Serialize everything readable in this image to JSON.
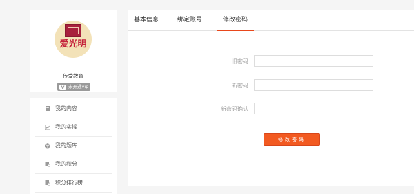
{
  "profile": {
    "logo_text": "爱光明",
    "username": "传爱教育",
    "vip_status": "未开通vip",
    "vip_mark": "V"
  },
  "sidebar": {
    "items": [
      {
        "label": "我的内容",
        "icon": "document-icon"
      },
      {
        "label": "我的实操",
        "icon": "practice-icon"
      },
      {
        "label": "我的题库",
        "icon": "question-bank-icon"
      },
      {
        "label": "我的积分",
        "icon": "points-icon"
      },
      {
        "label": "积分排行榜",
        "icon": "ranking-icon"
      }
    ]
  },
  "tabs": [
    {
      "label": "基本信息",
      "active": false
    },
    {
      "label": "绑定账号",
      "active": false
    },
    {
      "label": "修改密码",
      "active": true
    }
  ],
  "form": {
    "old_password_label": "旧密码",
    "new_password_label": "新密码",
    "confirm_password_label": "新密码确认",
    "old_password_value": "",
    "new_password_value": "",
    "confirm_password_value": "",
    "submit_label": "修改密码"
  },
  "colors": {
    "accent": "#f25a21",
    "tab_underline": "#e8481c",
    "badge_gray": "#9a9a9a",
    "logo_red": "#c4203a"
  }
}
